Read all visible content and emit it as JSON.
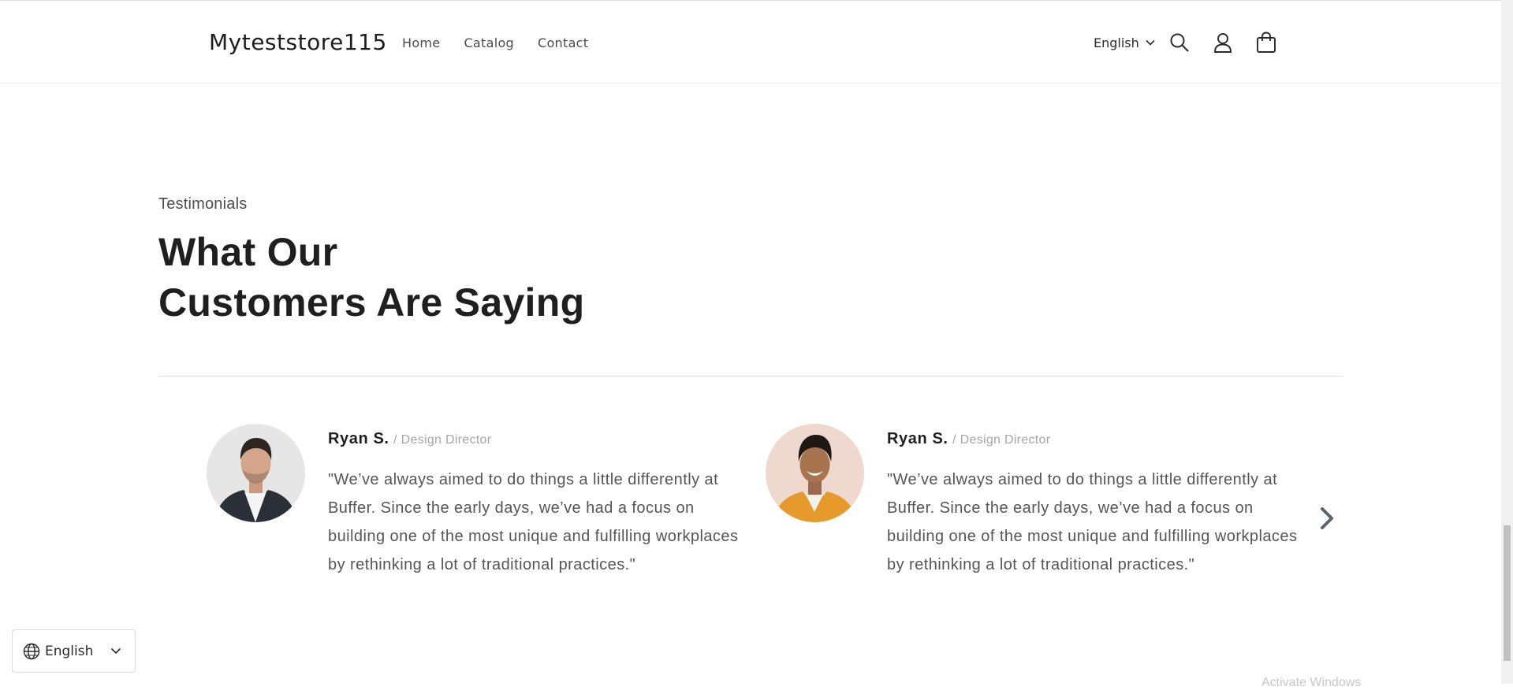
{
  "header": {
    "logo": "Myteststore115",
    "nav": [
      {
        "label": "Home"
      },
      {
        "label": "Catalog"
      },
      {
        "label": "Contact"
      }
    ],
    "language": "English",
    "icons": [
      "search-icon",
      "account-icon",
      "cart-icon"
    ]
  },
  "testimonials": {
    "eyebrow": "Testimonials",
    "title_line1": "What Our",
    "title_line2": "Customers Are Saying",
    "items": [
      {
        "name": "Ryan S.",
        "role": "/ Design Director",
        "quote": "\"We’ve always aimed to do things a little differently at Buffer. Since the early days, we’ve had a focus on building one of the most unique and fulfilling workplaces by rethinking a lot of traditional practices.\""
      },
      {
        "name": "Ryan S.",
        "role": "/ Design Director",
        "quote": "\"We’ve always aimed to do things a little differently at Buffer. Since the early days, we’ve had a focus on building one of the most unique and fulfilling workplaces by rethinking a lot of traditional practices.\""
      }
    ],
    "next_icon": "chevron-right-icon"
  },
  "floating_language": {
    "label": "English",
    "icons": [
      "globe-icon",
      "chevron-down-icon"
    ]
  },
  "watermark": "Activate Windows",
  "colors": {
    "heading": "#1f1f1f",
    "body_text": "#555555",
    "muted": "#a6a6a6",
    "divider": "#dddddd",
    "arrow": "#5c6270",
    "avatar1_bg": "#e6e6e6",
    "avatar2_bg": "#efd9ce",
    "jacket_orange": "#e59a2b"
  }
}
